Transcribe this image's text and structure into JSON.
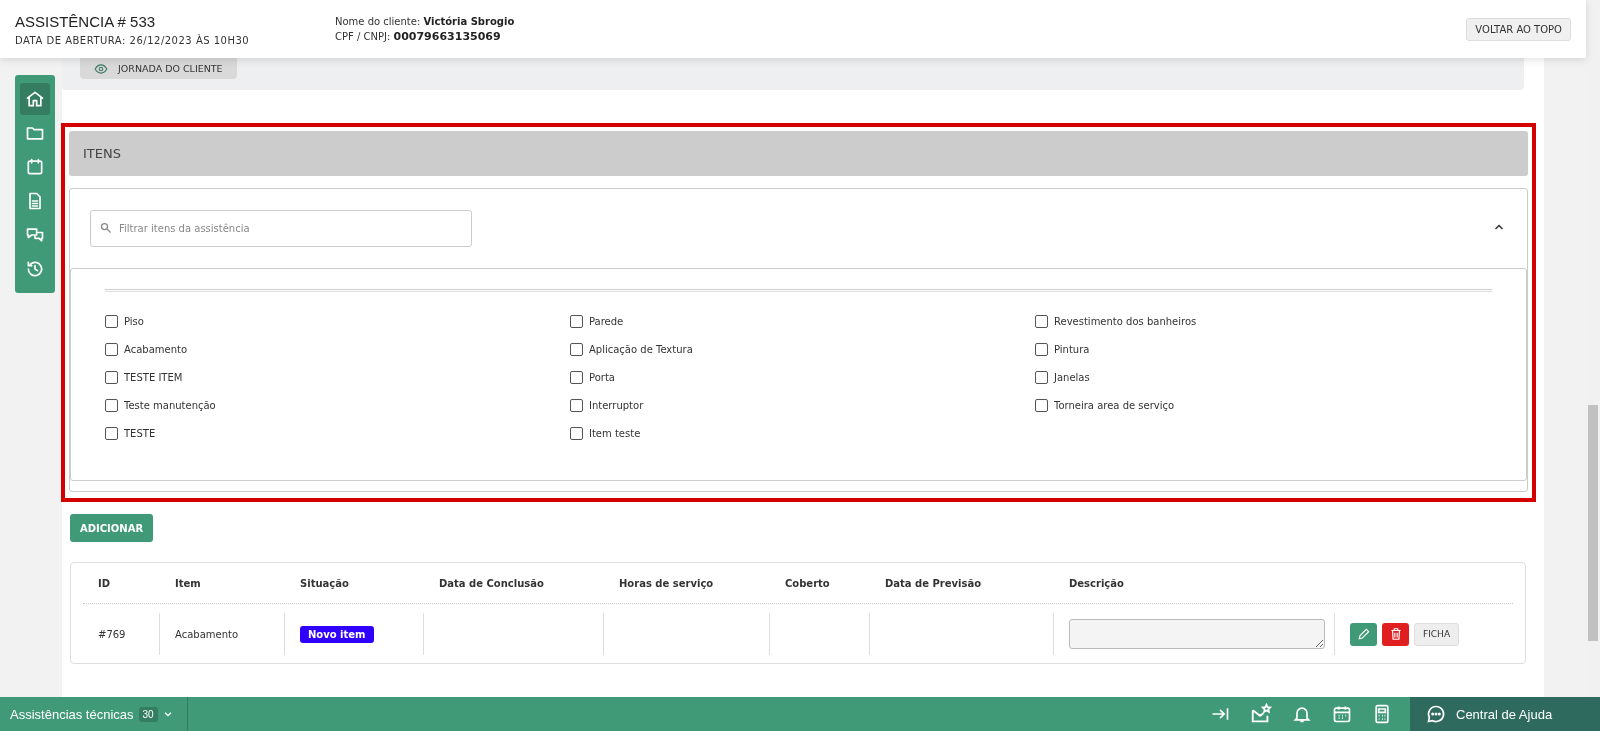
{
  "header": {
    "title": "ASSISTÊNCIA # 533",
    "opened": "DATA DE ABERTURA: 26/12/2023 ÀS 10H30",
    "client_label": "Nome do cliente:",
    "client_name": "Victória Sbrogio",
    "doc_label": "CPF / CNPJ:",
    "doc_value": "00079663135069",
    "back_button": "VOLTAR AO TOPO"
  },
  "sidebar": {
    "items": [
      {
        "kind": "home",
        "selected": true
      },
      {
        "kind": "folder",
        "selected": false
      },
      {
        "kind": "calendar",
        "selected": false
      },
      {
        "kind": "document",
        "selected": false
      },
      {
        "kind": "chat",
        "selected": false
      },
      {
        "kind": "history",
        "selected": false
      }
    ]
  },
  "journey_button": "JORNADA DO CLIENTE",
  "items_section": {
    "title": "ITENS",
    "search": {
      "placeholder": "Filtrar itens da assistência"
    },
    "expanded": true,
    "options": [
      {
        "label": "Piso",
        "checked": false
      },
      {
        "label": "Parede",
        "checked": false
      },
      {
        "label": "Revestimento dos banheiros",
        "checked": false
      },
      {
        "label": "Acabamento",
        "checked": false
      },
      {
        "label": "Aplicação de Textura",
        "checked": false
      },
      {
        "label": "Pintura",
        "checked": false
      },
      {
        "label": "TESTE ITEM",
        "checked": false
      },
      {
        "label": "Porta",
        "checked": false
      },
      {
        "label": "Janelas",
        "checked": false
      },
      {
        "label": "Teste manutenção",
        "checked": false
      },
      {
        "label": "Interruptor",
        "checked": false
      },
      {
        "label": "Torneira area de serviço",
        "checked": false
      },
      {
        "label": "TESTE",
        "checked": false
      },
      {
        "label": "Item teste",
        "checked": false
      }
    ]
  },
  "add_button": "ADICIONAR",
  "table": {
    "columns": [
      "ID",
      "Item",
      "Situação",
      "Data de Conclusão",
      "Horas de serviço",
      "Coberto",
      "Data de Previsão",
      "Descrição"
    ],
    "rows": [
      {
        "id": "#769",
        "item": "Acabamento",
        "status": {
          "label": "Novo item",
          "color": "#2f00ff"
        },
        "sheet_button": "FICHA"
      }
    ]
  },
  "bottom_bar": {
    "module": "Assistências técnicas",
    "count": "30",
    "help": "Central de Ajuda"
  }
}
